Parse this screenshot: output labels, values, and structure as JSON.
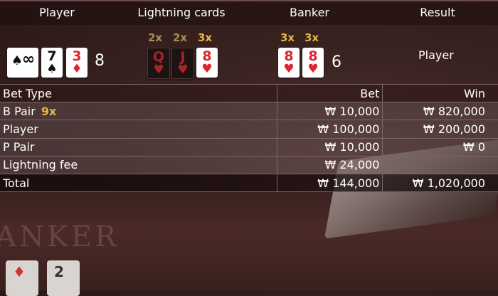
{
  "header": {
    "player": "Player",
    "lightning": "Lightning cards",
    "banker": "Banker",
    "result": "Result"
  },
  "player_hand": {
    "cards": [
      {
        "rank": "♠",
        "suit": "∞",
        "color": "black",
        "style": "hidden"
      },
      {
        "rank": "7",
        "suit": "♠",
        "color": "black"
      },
      {
        "rank": "3",
        "suit": "♦",
        "color": "red"
      }
    ],
    "score": "8"
  },
  "lightning_cards": [
    {
      "multiplier": "2x",
      "rank": "Q",
      "suit": "♥",
      "active": false
    },
    {
      "multiplier": "2x",
      "rank": "J",
      "suit": "♥",
      "active": false
    },
    {
      "multiplier": "3x",
      "rank": "8",
      "suit": "♥",
      "active": true
    }
  ],
  "banker_hand": {
    "cards": [
      {
        "multiplier": "3x",
        "rank": "8",
        "suit": "♥",
        "color": "red"
      },
      {
        "multiplier": "3x",
        "rank": "8",
        "suit": "♥",
        "color": "red"
      }
    ],
    "score": "6"
  },
  "result": "Player",
  "bets_table": {
    "headers": {
      "type": "Bet Type",
      "bet": "Bet",
      "win": "Win"
    },
    "rows": [
      {
        "type": "B Pair",
        "badge": "9x",
        "bet": "₩ 10,000",
        "win": "₩ 820,000"
      },
      {
        "type": "Player",
        "badge": "",
        "bet": "₩ 100,000",
        "win": "₩ 200,000"
      },
      {
        "type": "P Pair",
        "badge": "",
        "bet": "₩ 10,000",
        "win": "₩ 0"
      },
      {
        "type": "Lightning fee",
        "badge": "",
        "bet": "₩ 24,000",
        "win": ""
      }
    ],
    "total": {
      "label": "Total",
      "bet": "₩ 144,000",
      "win": "₩ 1,020,000"
    }
  },
  "background": {
    "table_text": "ANKER",
    "card_1": "♦",
    "card_2": "2"
  },
  "colors": {
    "multiplier_gold": "#e2b443",
    "multiplier_dim": "#a88a52",
    "card_red": "#e0232e"
  }
}
